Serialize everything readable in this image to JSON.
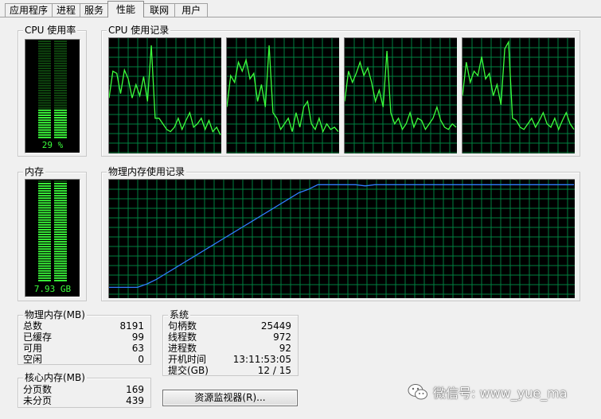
{
  "tabs": [
    {
      "label": "应用程序",
      "active": false
    },
    {
      "label": "进程",
      "active": false
    },
    {
      "label": "服务",
      "active": false
    },
    {
      "label": "性能",
      "active": true
    },
    {
      "label": "联网",
      "active": false
    },
    {
      "label": "用户",
      "active": false
    }
  ],
  "cpu_usage": {
    "title": "CPU 使用率",
    "value_label": "29 %",
    "percent": 29
  },
  "cpu_history": {
    "title": "CPU 使用记录"
  },
  "memory": {
    "title": "内存",
    "value_label": "7.93 GB",
    "percent": 97
  },
  "memory_history": {
    "title": "物理内存使用记录"
  },
  "physical_memory": {
    "title": "物理内存(MB)",
    "rows": [
      {
        "key": "总数",
        "value": "8191"
      },
      {
        "key": "已缓存",
        "value": "99"
      },
      {
        "key": "可用",
        "value": "63"
      },
      {
        "key": "空闲",
        "value": "0"
      }
    ]
  },
  "kernel_memory": {
    "title": "核心内存(MB)",
    "rows": [
      {
        "key": "分页数",
        "value": "169"
      },
      {
        "key": "未分页",
        "value": "439"
      }
    ]
  },
  "system": {
    "title": "系统",
    "rows": [
      {
        "key": "句柄数",
        "value": "25449"
      },
      {
        "key": "线程数",
        "value": "972"
      },
      {
        "key": "进程数",
        "value": "92"
      },
      {
        "key": "开机时间",
        "value": "13:11:53:05"
      },
      {
        "key": "提交(GB)",
        "value": "12 / 15"
      }
    ]
  },
  "resource_monitor_button": {
    "label": "资源监视器(R)..."
  },
  "watermark": {
    "label": "微信号: www_yue_ma"
  },
  "chart_data": [
    {
      "type": "line",
      "series": [
        {
          "values": [
            48,
            72,
            70,
            52,
            73,
            65,
            48,
            60,
            50,
            67,
            45,
            95,
            30,
            30,
            25,
            20,
            18,
            22,
            30,
            20,
            28,
            35,
            22,
            25,
            30,
            20,
            28,
            18,
            22,
            15
          ]
        },
        {
          "values": [
            40,
            68,
            62,
            80,
            72,
            82,
            65,
            70,
            45,
            60,
            40,
            95,
            35,
            30,
            20,
            25,
            30,
            18,
            35,
            22,
            40,
            45,
            25,
            20,
            30,
            18,
            25,
            20,
            22,
            18
          ]
        },
        {
          "values": [
            45,
            72,
            62,
            70,
            80,
            68,
            75,
            62,
            45,
            55,
            40,
            90,
            35,
            25,
            30,
            20,
            25,
            35,
            22,
            30,
            28,
            20,
            25,
            30,
            40,
            28,
            22,
            20,
            25,
            22
          ]
        },
        {
          "values": [
            50,
            80,
            62,
            72,
            68,
            85,
            65,
            70,
            50,
            60,
            42,
            92,
            98,
            30,
            28,
            22,
            20,
            25,
            30,
            22,
            28,
            35,
            25,
            22,
            30,
            20,
            28,
            35,
            25,
            20
          ]
        }
      ],
      "ylim": [
        0,
        100
      ],
      "grid": true
    },
    {
      "type": "line",
      "series": [
        {
          "values": [
            8,
            8,
            8,
            8,
            11,
            15,
            20,
            25,
            30,
            35,
            40,
            45,
            50,
            55,
            60,
            65,
            70,
            75,
            80,
            85,
            90,
            93,
            97,
            97,
            97,
            97,
            97,
            96,
            97,
            97,
            97,
            97,
            97,
            97,
            97,
            97,
            97,
            97,
            97,
            97,
            97,
            97,
            97,
            97,
            97,
            97,
            97,
            97,
            97,
            97
          ]
        }
      ],
      "ylim": [
        0,
        100
      ],
      "grid": true
    }
  ]
}
